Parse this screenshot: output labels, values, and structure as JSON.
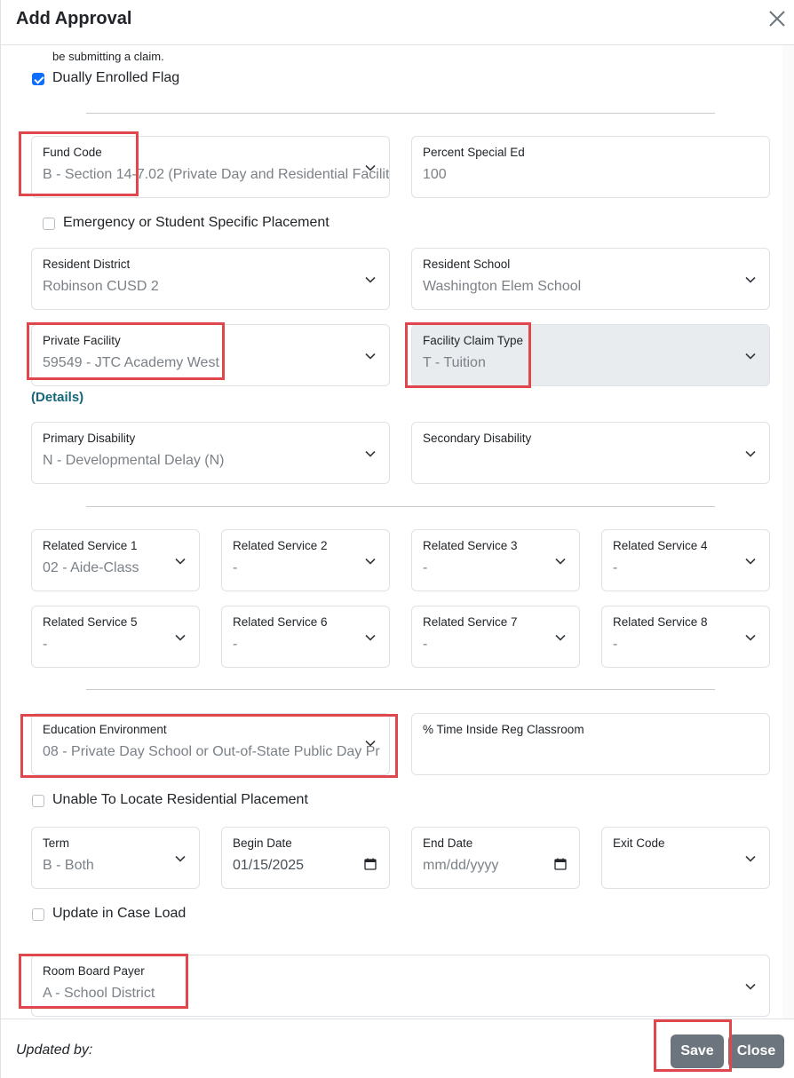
{
  "modal": {
    "title": "Add Approval"
  },
  "body": {
    "claim_text": "be submitting a claim.",
    "dually_enrolled_label": "Dually Enrolled Flag",
    "dually_enrolled_checked": true,
    "fund_code": {
      "label": "Fund Code",
      "value": "B - Section 14-7.02 (Private Day and Residential Facilit"
    },
    "percent_special_ed": {
      "label": "Percent Special Ed",
      "value": "100"
    },
    "emergency_label": "Emergency or Student Specific Placement",
    "resident_district": {
      "label": "Resident District",
      "value": "Robinson CUSD 2"
    },
    "resident_school": {
      "label": "Resident School",
      "value": "Washington Elem School"
    },
    "private_facility": {
      "label": "Private Facility",
      "value": "59549 - JTC Academy West"
    },
    "facility_claim_type": {
      "label": "Facility Claim Type",
      "value": "T - Tuition"
    },
    "details_link": "(Details)",
    "primary_disability": {
      "label": "Primary Disability",
      "value": "N - Developmental Delay (N)"
    },
    "secondary_disability": {
      "label": "Secondary Disability",
      "value": ""
    },
    "related_services": [
      {
        "label": "Related Service 1",
        "value": "02 - Aide-Class"
      },
      {
        "label": "Related Service 2",
        "value": "-"
      },
      {
        "label": "Related Service 3",
        "value": "-"
      },
      {
        "label": "Related Service 4",
        "value": "-"
      },
      {
        "label": "Related Service 5",
        "value": "-"
      },
      {
        "label": "Related Service 6",
        "value": "-"
      },
      {
        "label": "Related Service 7",
        "value": "-"
      },
      {
        "label": "Related Service 8",
        "value": "-"
      }
    ],
    "education_environment": {
      "label": "Education Environment",
      "value": "08 - Private Day School or Out-of-State Public Day Pro"
    },
    "time_inside_reg": {
      "label": "% Time Inside Reg Classroom",
      "value": ""
    },
    "unable_locate_label": "Unable To Locate Residential Placement",
    "term": {
      "label": "Term",
      "value": "B - Both"
    },
    "begin_date": {
      "label": "Begin Date",
      "value": "01/15/2025"
    },
    "end_date": {
      "label": "End Date",
      "value": "mm/dd/yyyy"
    },
    "exit_code": {
      "label": "Exit Code",
      "value": ""
    },
    "update_caseload_label": "Update in Case Load",
    "room_board_payer": {
      "label": "Room Board Payer",
      "value": "A - School District"
    }
  },
  "footer": {
    "updated_by": "Updated by:",
    "save_label": "Save",
    "close_label": "Close"
  },
  "colors": {
    "highlight": "#e0474c",
    "button": "#6c757d",
    "link": "#17667a",
    "checkbox": "#0d6efd"
  },
  "icons": [
    "close-icon",
    "chevron-down-icon",
    "calendar-icon",
    "checkbox-checked-icon"
  ]
}
